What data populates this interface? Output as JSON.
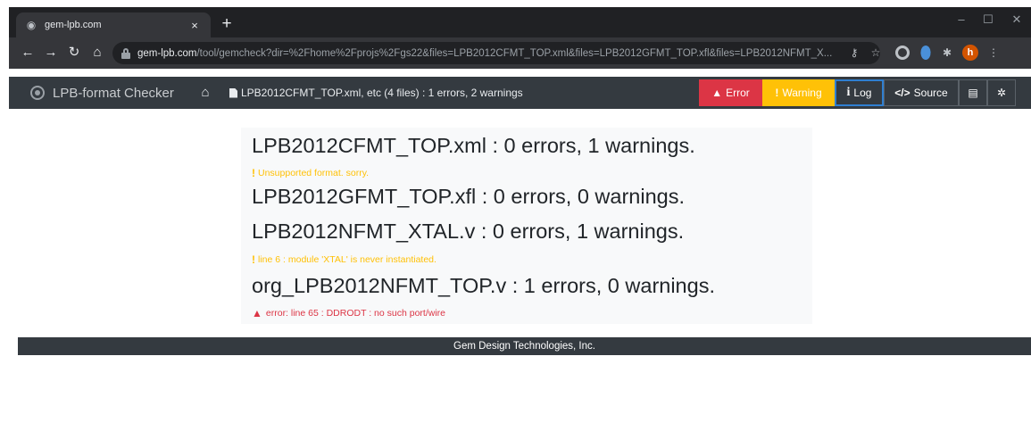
{
  "browser": {
    "tab_title": "gem-lpb.com",
    "tab_close": "×",
    "new_tab": "+",
    "win_minimize": "–",
    "win_maximize": "☐",
    "win_close": "✕",
    "url_host": "gem-lpb.com",
    "url_path": "/tool/gemcheck?dir=%2Fhome%2Fprojs%2Fgs22&files=LPB2012CFMT_TOP.xml&files=LPB2012GFMT_TOP.xfl&files=LPB2012NFMT_X...",
    "avatar_letter": "h",
    "colors": {
      "chrome_dark": "#202124",
      "chrome_tab": "#35363a"
    }
  },
  "app": {
    "brand": "LPB-format Checker",
    "breadcrumb": "LPB2012CFMT_TOP.xml, etc (4 files) : 1 errors, 2 warnings",
    "buttons": {
      "error": "Error",
      "warning": "Warning",
      "log": "Log",
      "source": "Source"
    },
    "colors": {
      "navbar": "#343a40",
      "error": "#dc3545",
      "warning": "#ffc107",
      "log_border": "#2f7fd1"
    }
  },
  "report": {
    "files": [
      {
        "heading": "LPB2012CFMT_TOP.xml : 0 errors, 1 warnings.",
        "message": "Unsupported format. sorry.",
        "message_type": "warning"
      },
      {
        "heading": "LPB2012GFMT_TOP.xfl : 0 errors, 0 warnings."
      },
      {
        "heading": "LPB2012NFMT_XTAL.v : 0 errors, 1 warnings.",
        "message": "line 6 : module 'XTAL' is never instantiated.",
        "message_type": "warning"
      },
      {
        "heading": "org_LPB2012NFMT_TOP.v : 1 errors, 0 warnings.",
        "message": "error: line 65 : DDRODT : no such port/wire",
        "message_type": "error"
      }
    ]
  },
  "footer": {
    "text": "Gem Design Technologies, Inc."
  }
}
